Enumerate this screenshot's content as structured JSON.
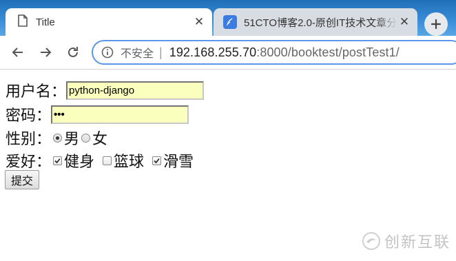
{
  "browser": {
    "active_tab": {
      "title": "Title",
      "icon": "document-icon"
    },
    "inactive_tab": {
      "title": "51CTO博客2.0-原创IT技术文章分",
      "icon": "feather-icon"
    },
    "close_glyph": "✕",
    "address_bar": {
      "security_label": "不安全",
      "separator": "|",
      "url_host": "192.168.255.70",
      "url_rest": ":8000/booktest/postTest1/"
    }
  },
  "form": {
    "username_label": "用户名：",
    "username_value": "python-django",
    "password_label": "密码：",
    "password_value": "•••",
    "gender_label": "性别：",
    "gender_options": [
      {
        "label": "男",
        "checked": true
      },
      {
        "label": "女",
        "checked": false
      }
    ],
    "hobby_label": "爱好：",
    "hobby_options": [
      {
        "label": "健身",
        "checked": true
      },
      {
        "label": "篮球",
        "checked": false
      },
      {
        "label": "滑雪",
        "checked": true
      }
    ],
    "submit_label": "提交"
  },
  "watermark": {
    "text": "创新互联"
  },
  "colors": {
    "autofill": "#faffbd",
    "tabbar": "#2f80cc",
    "omnibox_border": "#5b95e8"
  }
}
